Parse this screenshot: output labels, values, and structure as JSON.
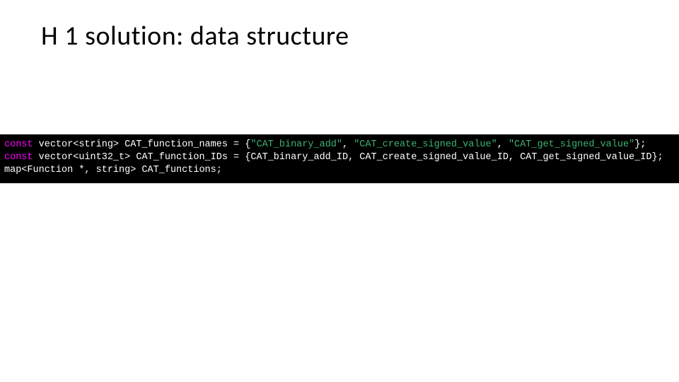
{
  "title": "H 1 solution: data structure",
  "code": {
    "line1": {
      "kw": "const",
      "decl": " vector<string> CAT_function_names = {",
      "s1": "\"CAT_binary_add\"",
      "c1": ", ",
      "s2": "\"CAT_create_signed_value\"",
      "c2": ", ",
      "s3": "\"CAT_get_signed_value\"",
      "end": "};"
    },
    "line2": {
      "kw": "const",
      "rest": " vector<uint32_t> CAT_function_IDs = {CAT_binary_add_ID, CAT_create_signed_value_ID, CAT_get_signed_value_ID};"
    },
    "line3": {
      "rest": "map<Function *, string> CAT_functions;"
    }
  }
}
